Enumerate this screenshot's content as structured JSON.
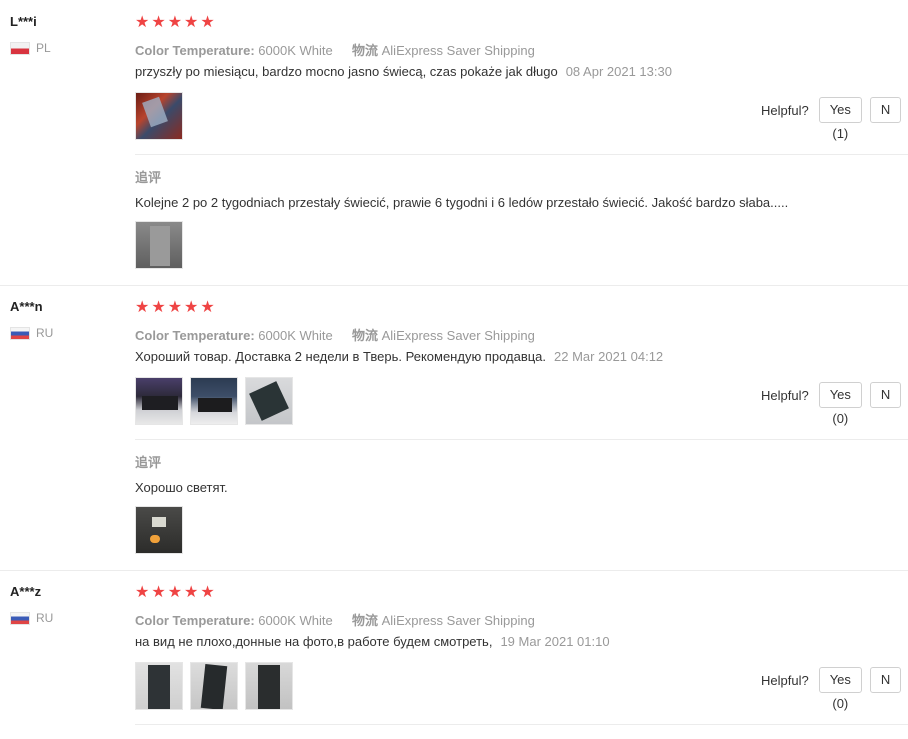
{
  "reviews": [
    {
      "user": "L***i",
      "country": "PL",
      "flag": "pl",
      "stars": 5,
      "props": {
        "color_label": "Color Temperature:",
        "color_value": "6000K White",
        "shipping_label": "物流",
        "shipping_value": "AliExpress Saver Shipping"
      },
      "text": "przyszły po miesiącu, bardzo mocno jasno świecą, czas pokaże jak długo",
      "date": "08 Apr 2021 13:30",
      "photos": 1,
      "helpful_label": "Helpful?",
      "yes": "Yes (1)",
      "no": "N",
      "follow_label": "追评",
      "follow_text": "Kolejne 2 po 2 tygodniach przestały świecić, prawie 6 tygodni i 6 ledów przestało świecić. Jakość bardzo słaba.....",
      "follow_photos": 1
    },
    {
      "user": "A***n",
      "country": "RU",
      "flag": "ru",
      "stars": 5,
      "props": {
        "color_label": "Color Temperature:",
        "color_value": "6000K White",
        "shipping_label": "物流",
        "shipping_value": "AliExpress Saver Shipping"
      },
      "text": "Хороший товар. Доставка 2 недели в Тверь. Рекомендую продавца.",
      "date": "22 Mar 2021 04:12",
      "photos": 3,
      "helpful_label": "Helpful?",
      "yes": "Yes (0)",
      "no": "N",
      "follow_label": "追评",
      "follow_text": "Хорошо светят.",
      "follow_photos": 1
    },
    {
      "user": "A***z",
      "country": "RU",
      "flag": "ru",
      "stars": 5,
      "props": {
        "color_label": "Color Temperature:",
        "color_value": "6000K White",
        "shipping_label": "物流",
        "shipping_value": "AliExpress Saver Shipping"
      },
      "text": "на вид не плохо,донные на фото,в работе будем смотреть,",
      "date": "19 Mar 2021 01:10",
      "photos": 3,
      "helpful_label": "Helpful?",
      "yes": "Yes (0)",
      "no": "N"
    }
  ],
  "colors": {
    "star": "#ef4444",
    "muted": "#999999",
    "text": "#333333",
    "border": "#d0d0d0"
  }
}
